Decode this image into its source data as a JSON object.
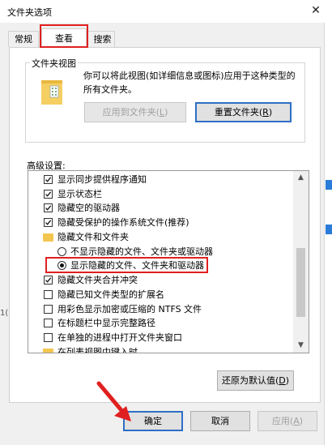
{
  "window": {
    "title": "文件夹选项",
    "close_glyph": "✕"
  },
  "tabs": [
    {
      "label": "常规",
      "active": false
    },
    {
      "label": "查看",
      "active": true
    },
    {
      "label": "搜索",
      "active": false
    }
  ],
  "folder_views": {
    "group_label": "文件夹视图",
    "description": "你可以将此视图(如详细信息或图标)应用于这种类型的所有文件夹。",
    "apply_button": {
      "text": "应用到文件夹(",
      "key": "L",
      "end": ")"
    },
    "reset_button": {
      "text": "重置文件夹(",
      "key": "R",
      "end": ")"
    }
  },
  "advanced": {
    "label": "高级设置:",
    "items": [
      {
        "type": "checkbox",
        "checked": true,
        "label": "显示同步提供程序通知",
        "indent": 0
      },
      {
        "type": "checkbox",
        "checked": true,
        "label": "显示状态栏",
        "indent": 0
      },
      {
        "type": "checkbox",
        "checked": true,
        "label": "隐藏空的驱动器",
        "indent": 0
      },
      {
        "type": "checkbox",
        "checked": true,
        "label": "隐藏受保护的操作系统文件(推荐)",
        "indent": 0
      },
      {
        "type": "folder",
        "label": "隐藏文件和文件夹",
        "indent": 0
      },
      {
        "type": "radio",
        "checked": false,
        "label": "不显示隐藏的文件、文件夹或驱动器",
        "indent": 1
      },
      {
        "type": "radio",
        "checked": true,
        "label": "显示隐藏的文件、文件夹和驱动器",
        "indent": 1
      },
      {
        "type": "checkbox",
        "checked": true,
        "label": "隐藏文件夹合并冲突",
        "indent": 0
      },
      {
        "type": "checkbox",
        "checked": false,
        "label": "隐藏已知文件类型的扩展名",
        "indent": 0
      },
      {
        "type": "checkbox",
        "checked": false,
        "label": "用彩色显示加密或压缩的 NTFS 文件",
        "indent": 0
      },
      {
        "type": "checkbox",
        "checked": false,
        "label": "在标题栏中显示完整路径",
        "indent": 0
      },
      {
        "type": "checkbox",
        "checked": false,
        "label": "在单独的进程中打开文件夹窗口",
        "indent": 0
      },
      {
        "type": "folder",
        "label": "在列表视图中键入时",
        "indent": 0
      }
    ],
    "restore_button": {
      "text": "还原为默认值(",
      "key": "D",
      "end": ")"
    }
  },
  "footer": {
    "ok": "确定",
    "cancel": "取消",
    "apply": {
      "text": "应用(",
      "key": "A",
      "end": ")"
    }
  },
  "colors": {
    "highlight_red": "#e02020",
    "focus_blue": "#2f6fc5",
    "folder_yellow": "#f3c650"
  },
  "background_fragment": "1("
}
